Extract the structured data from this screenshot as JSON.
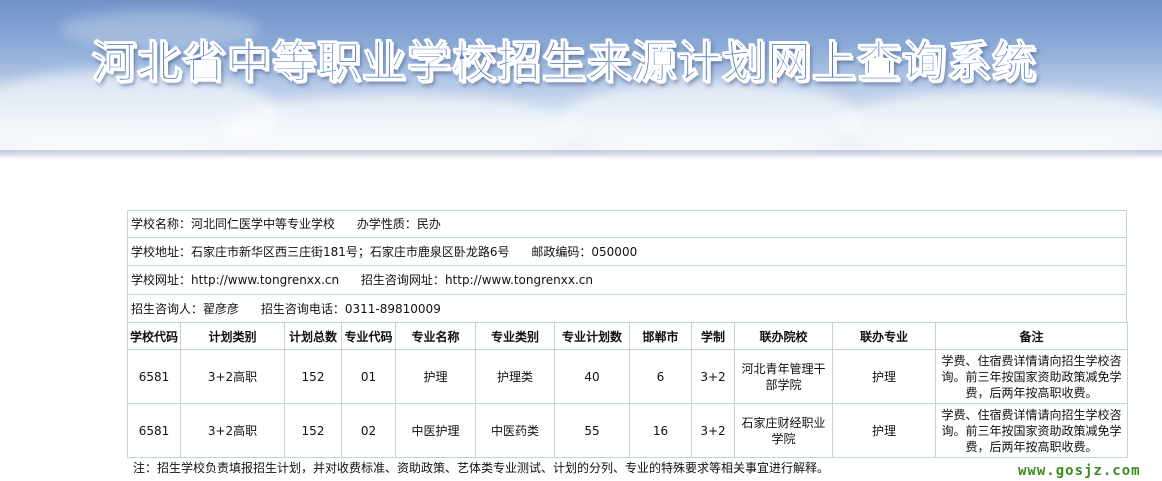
{
  "banner": {
    "title": "河北省中等职业学校招生来源计划网上查询系统"
  },
  "school": {
    "name_label": "学校名称：",
    "name": "河北同仁医学中等专业学校",
    "nature_label": "办学性质：",
    "nature": "民办",
    "address_label": "学校地址：",
    "address": "石家庄市新华区西三庄街181号；石家庄市鹿泉区卧龙路6号",
    "postcode_label": "邮政编码：",
    "postcode": "050000",
    "website_label": "学校网址：",
    "website": "http://www.tongrenxx.cn",
    "admission_site_label": "招生咨询网址：",
    "admission_site": "http://www.tongrenxx.cn",
    "contact_label": "招生咨询人：",
    "contact": "翟彦彦",
    "phone_label": "招生咨询电话：",
    "phone": "0311-89810009"
  },
  "table": {
    "headers": [
      "学校代码",
      "计划类别",
      "计划总数",
      "专业代码",
      "专业名称",
      "专业类别",
      "专业计划数",
      "邯郸市",
      "学制",
      "联办院校",
      "联办专业",
      "备注"
    ],
    "rows": [
      [
        "6581",
        "3+2高职",
        "152",
        "01",
        "护理",
        "护理类",
        "40",
        "6",
        "3+2",
        "河北青年管理干部学院",
        "护理",
        "学费、住宿费详情请向招生学校咨询。前三年按国家资助政策减免学费，后两年按高职收费。"
      ],
      [
        "6581",
        "3+2高职",
        "152",
        "02",
        "中医护理",
        "中医药类",
        "55",
        "16",
        "3+2",
        "石家庄财经职业学院",
        "护理",
        "学费、住宿费详情请向招生学校咨询。前三年按国家资助政策减免学费，后两年按高职收费。"
      ]
    ]
  },
  "note": "注：招生学校负责填报招生计划，并对收费标准、资助政策、艺体类专业测试、计划的分列、专业的特殊要求等相关事宜进行解释。",
  "watermark": "www.gosjz.com"
}
